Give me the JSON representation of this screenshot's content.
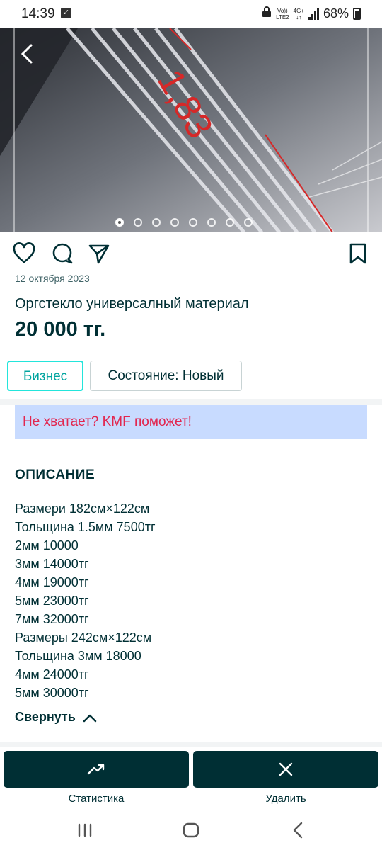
{
  "status_bar": {
    "time": "14:39",
    "network_top": "Vo))",
    "network_bottom": "LTE2",
    "data_top": "4G+",
    "data_bottom": "↓↑",
    "battery": "68%"
  },
  "gallery": {
    "photo_count": 8,
    "active_index": 0,
    "photo_overlay_text": "1,83"
  },
  "listing": {
    "date": "12 октября 2023",
    "title": "Оргстекло универсалный материал",
    "price": "20 000 тг."
  },
  "tags": {
    "business": "Бизнес",
    "condition": "Состояние: Новый"
  },
  "promo": {
    "text": "Не хватает? KMF поможет!"
  },
  "description": {
    "heading": "ОПИСАНИЕ",
    "lines": [
      "Размери 182см×122см",
      "Тольщина 1.5мм 7500тг",
      "2мм 10000",
      "3мм 14000тг",
      "4мм 19000тг",
      "5мм 23000тг",
      "7мм 32000тг",
      "Размеры 242см×122см",
      "Тольщина 3мм 18000",
      "4мм 24000тг",
      "5мм 30000тг"
    ],
    "collapse_label": "Свернуть"
  },
  "bottom_actions": {
    "stats_label": "Статистика",
    "delete_label": "Удалить"
  },
  "colors": {
    "primary": "#002f34",
    "accent_teal": "#23e5db",
    "promo_bg": "#c8dbff",
    "promo_text": "#e2264f"
  }
}
